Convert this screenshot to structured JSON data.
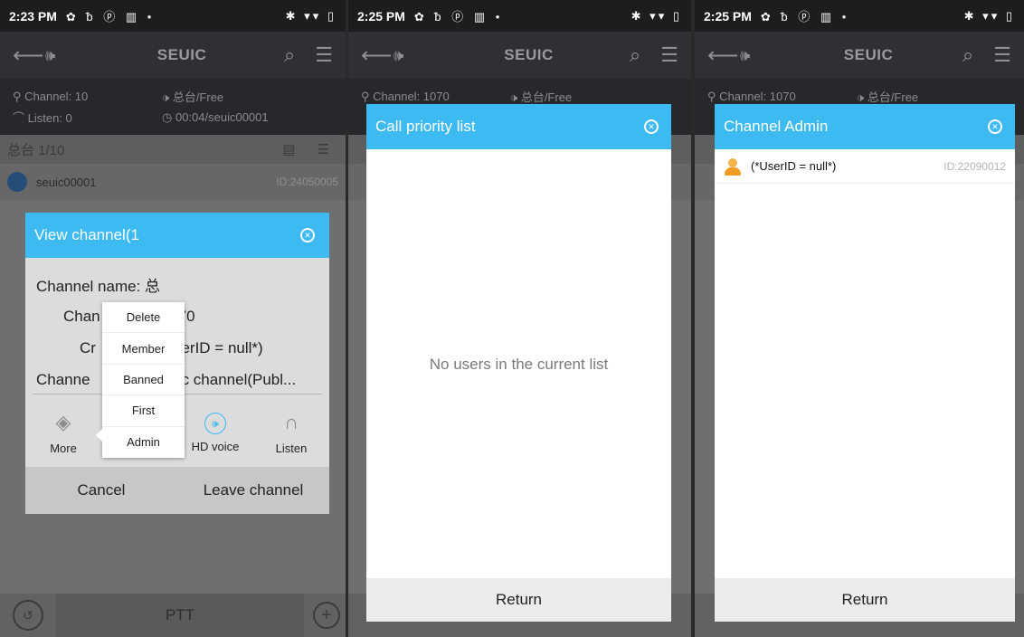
{
  "panel1": {
    "status": {
      "time": "2:23 PM",
      "left_icons": "✿ ᵬ ⓟ ▥ •",
      "right_icons": "✱ ▾▾ ▯"
    },
    "appbar": {
      "brand": "SEUIC"
    },
    "info": {
      "channel": "Channel: 10",
      "audio": "总台/Free",
      "listen": "Listen: 0",
      "timer": "00:04/seuic00001"
    },
    "group": {
      "name": "总台 1/10"
    },
    "user": {
      "name": "seuic00001",
      "id": "ID:24050005"
    },
    "dialog": {
      "title": "View channel(1",
      "rows": [
        "Channel name: 总",
        "Chan",
        "Cr",
        "Channe"
      ],
      "rows_right": [
        "",
        "70",
        "serID = null*)",
        "blic channel(Publ..."
      ],
      "actions": [
        {
          "label": "More",
          "icon": "layers-icon"
        },
        {
          "label": "",
          "icon": ""
        },
        {
          "label": "HD voice",
          "icon": "speaker-icon"
        },
        {
          "label": "Listen",
          "icon": "headphones-icon"
        }
      ],
      "cancel": "Cancel",
      "leave": "Leave channel"
    },
    "menu": [
      "Delete",
      "Member",
      "Banned",
      "First",
      "Admin"
    ],
    "bottom": {
      "ptt": "PTT"
    }
  },
  "panel2": {
    "status": {
      "time": "2:25 PM",
      "left_icons": "✿ ᵬ ⓟ ▥ •",
      "right_icons": "✱ ▾▾ ▯"
    },
    "appbar": {
      "brand": "SEUIC"
    },
    "info": {
      "channel": "Channel: 1070",
      "audio": "总台/Free"
    },
    "dialog": {
      "title": "Call priority list",
      "empty": "No users in the current list",
      "footer": "Return"
    }
  },
  "panel3": {
    "status": {
      "time": "2:25 PM",
      "left_icons": "✿ ᵬ ⓟ ▥ •",
      "right_icons": "✱ ▾▾ ▯"
    },
    "appbar": {
      "brand": "SEUIC"
    },
    "info": {
      "channel": "Channel: 1070",
      "audio": "总台/Free"
    },
    "dialog": {
      "title": "Channel Admin",
      "admin_name": "(*UserID = null*)",
      "admin_id": "ID:22090012",
      "footer": "Return"
    }
  },
  "colors": {
    "accent": "#3dbaf1",
    "dim_bg": "#6f6f6f"
  }
}
